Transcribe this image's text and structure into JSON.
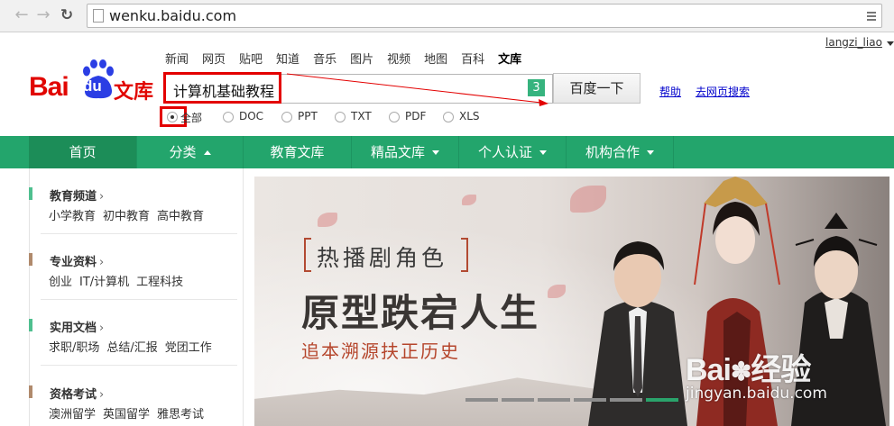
{
  "browser": {
    "back_icon": "arrow-left-icon",
    "forward_icon": "arrow-right-icon",
    "reload_icon": "reload-icon",
    "url": "wenku.baidu.com"
  },
  "header": {
    "username": "langzi_liao",
    "logo_alt": "Bai du 文库",
    "top_nav": [
      {
        "label": "新闻"
      },
      {
        "label": "网页"
      },
      {
        "label": "贴吧"
      },
      {
        "label": "知道"
      },
      {
        "label": "音乐"
      },
      {
        "label": "图片"
      },
      {
        "label": "视频"
      },
      {
        "label": "地图"
      },
      {
        "label": "百科"
      },
      {
        "label": "文库",
        "active": true
      }
    ],
    "search": {
      "value": "计算机基础教程",
      "count_badge": "3",
      "button_label": "百度一下"
    },
    "help_link": "帮助",
    "web_search_link": "去网页搜索",
    "filters": [
      {
        "label": "全部",
        "checked": true
      },
      {
        "label": "DOC",
        "checked": false
      },
      {
        "label": "PPT",
        "checked": false
      },
      {
        "label": "TXT",
        "checked": false
      },
      {
        "label": "PDF",
        "checked": false
      },
      {
        "label": "XLS",
        "checked": false
      }
    ],
    "annotation_color": "#e30000"
  },
  "main_nav": {
    "accent_color": "#23a56c",
    "items": [
      {
        "label": "首页",
        "caret": "none"
      },
      {
        "label": "分类",
        "caret": "up"
      },
      {
        "label": "教育文库",
        "caret": "none"
      },
      {
        "label": "精品文库",
        "caret": "down"
      },
      {
        "label": "个人认证",
        "caret": "down"
      },
      {
        "label": "机构合作",
        "caret": "down"
      }
    ]
  },
  "sidebar": {
    "sections": [
      {
        "title": "教育频道",
        "color": "#4fbf8f",
        "links": [
          "小学教育",
          "初中教育",
          "高中教育"
        ]
      },
      {
        "title": "专业资料",
        "color": "#b08a6c",
        "links": [
          "创业",
          "IT/计算机",
          "工程科技"
        ]
      },
      {
        "title": "实用文档",
        "color": "#4fbf8f",
        "links": [
          "求职/职场",
          "总结/汇报",
          "党团工作"
        ]
      },
      {
        "title": "资格考试",
        "color": "#b08a6c",
        "links": [
          "澳洲留学",
          "英国留学",
          "雅思考试"
        ]
      }
    ]
  },
  "banner": {
    "tag": "热播剧角色",
    "title": "原型跌宕人生",
    "subtitle": "追本溯源扶正历史",
    "slides_total": 6,
    "active_slide": 6
  },
  "watermark": {
    "logo": "Bai du 经验",
    "url": "jingyan.baidu.com"
  }
}
